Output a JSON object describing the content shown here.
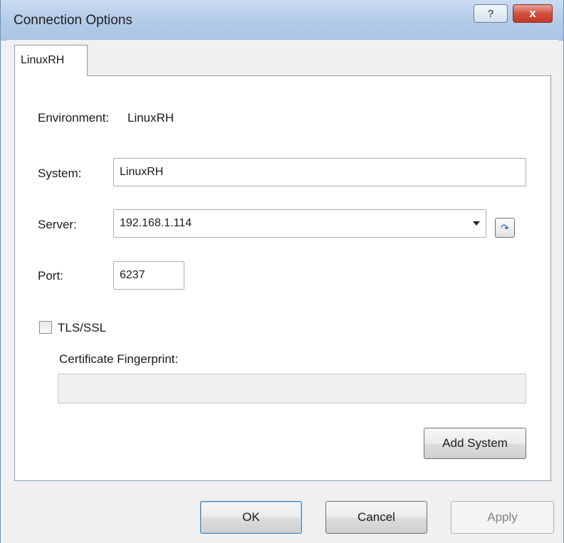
{
  "window": {
    "title": "Connection Options",
    "help_label": "?",
    "close_label": "x"
  },
  "tab": {
    "label": "LinuxRH"
  },
  "form": {
    "environment_label": "Environment:",
    "environment_value": "LinuxRH",
    "system_label": "System:",
    "system_value": "LinuxRH",
    "server_label": "Server:",
    "server_value": "192.168.1.114",
    "port_label": "Port:",
    "port_value": "6237",
    "tls_label": "TLS/SSL",
    "tls_checked": false,
    "fingerprint_label": "Certificate Fingerprint:",
    "fingerprint_value": "",
    "add_system_label": "Add System"
  },
  "footer": {
    "ok_label": "OK",
    "cancel_label": "Cancel",
    "apply_label": "Apply"
  }
}
